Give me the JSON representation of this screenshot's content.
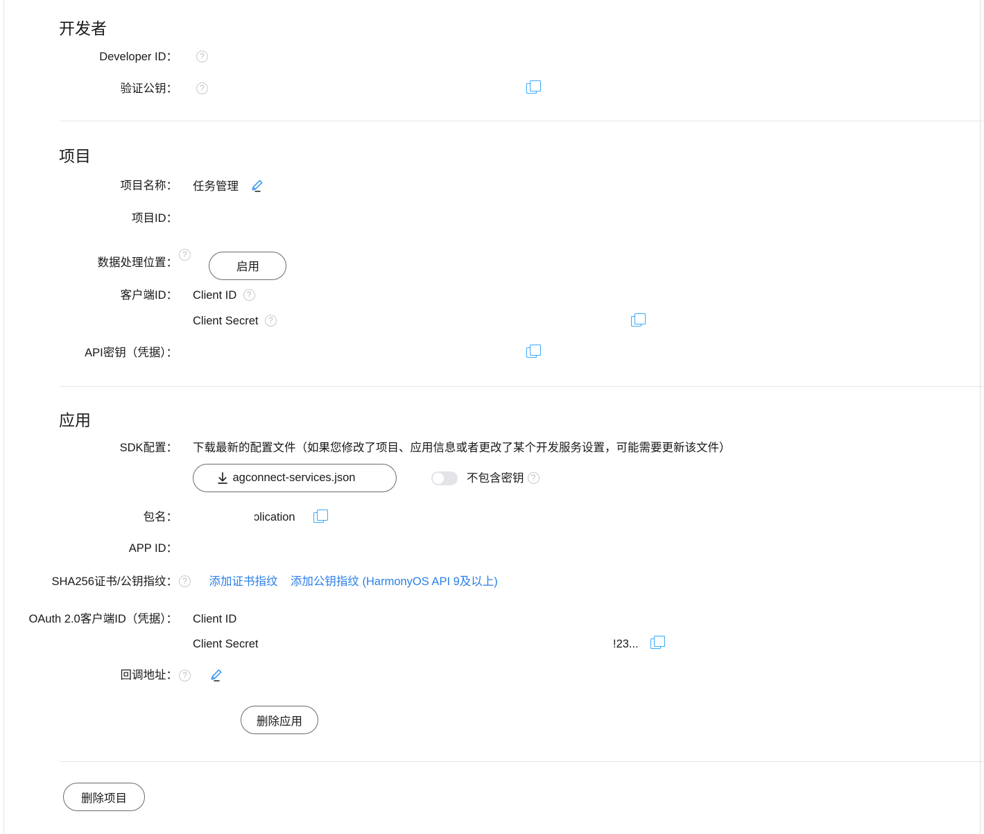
{
  "sections": {
    "developer": {
      "title": "开发者",
      "rows": {
        "developer_id": {
          "label": "Developer ID：",
          "value": ""
        },
        "verify_public_key": {
          "label": "验证公钥：",
          "value": ""
        }
      }
    },
    "project": {
      "title": "项目",
      "rows": {
        "project_name": {
          "label": "项目名称：",
          "value": "任务管理"
        },
        "project_id": {
          "label": "项目ID：",
          "value": ""
        },
        "data_location": {
          "label": "数据处理位置：",
          "button": "启用"
        },
        "client_id": {
          "label": "客户端ID：",
          "value": "Client ID",
          "secret": "Client Secret"
        },
        "api_key": {
          "label": "API密钥（凭据）：",
          "value": ""
        }
      }
    },
    "app": {
      "title": "应用",
      "rows": {
        "sdk_config": {
          "label": "SDK配置：",
          "description": "下载最新的配置文件（如果您修改了项目、应用信息或者更改了某个开发服务设置，可能需要更新该文件）",
          "download_button": "agconnect-services.json",
          "toggle_label": "不包含密钥"
        },
        "package_name": {
          "label": "包名：",
          "value": "ɔlication"
        },
        "app_id": {
          "label": "APP ID：",
          "value": ""
        },
        "sha256": {
          "label": "SHA256证书/公钥指纹：",
          "link_cert": "添加证书指纹",
          "link_public_key": "添加公钥指纹 (HarmonyOS API 9及以上)"
        },
        "oauth": {
          "label": "OAuth 2.0客户端ID（凭据）：",
          "client_id": "Client ID",
          "client_secret": "Client Secret",
          "secret_value": "!23..."
        },
        "callback_url": {
          "label": "回调地址：",
          "value": ""
        }
      },
      "delete_app_button": "删除应用"
    },
    "footer": {
      "delete_project_button": "删除项目"
    }
  },
  "icons": {
    "help": "help-circle-icon",
    "copy": "copy-icon",
    "edit": "pencil-edit-icon",
    "download": "download-arrow-icon"
  },
  "colors": {
    "link": "#2a7fe8",
    "icon_blue": "#36a9fb",
    "text": "#191919",
    "divider": "#e6e6e6"
  }
}
